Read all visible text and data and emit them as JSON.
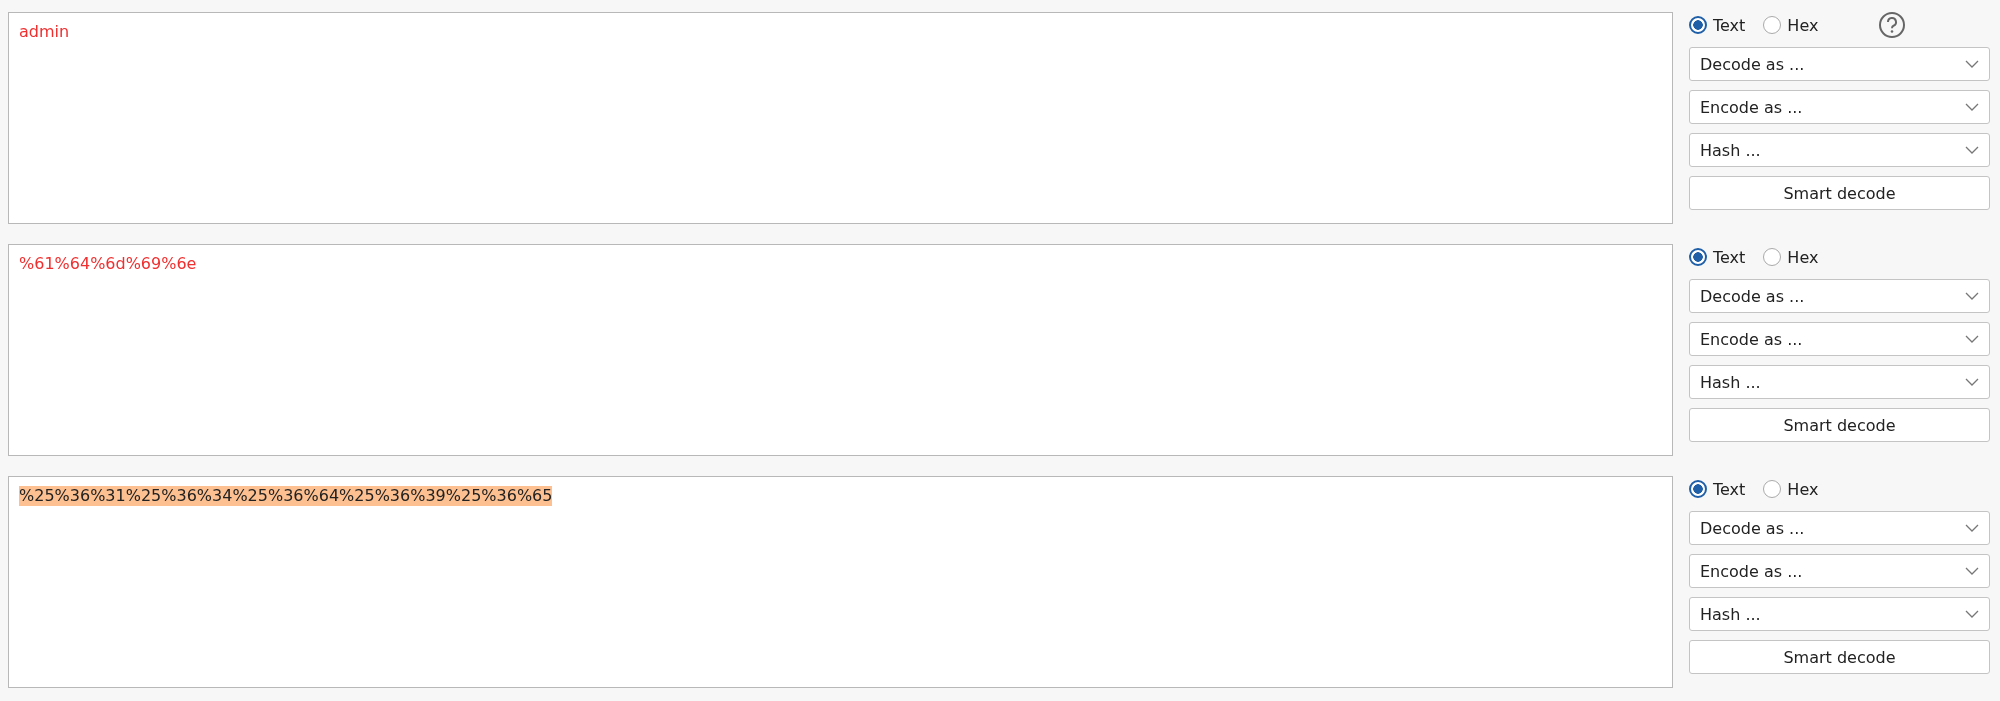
{
  "panels": [
    {
      "text": "admin",
      "kind": "modified",
      "formats": [
        {
          "label": "Text",
          "selected": true
        },
        {
          "label": "Hex",
          "selected": false
        }
      ],
      "help": true,
      "dropdowns": [
        "Decode as ...",
        "Encode as ...",
        "Hash ..."
      ],
      "button": "Smart decode"
    },
    {
      "text": "%61%64%6d%69%6e",
      "kind": "modified",
      "formats": [
        {
          "label": "Text",
          "selected": true
        },
        {
          "label": "Hex",
          "selected": false
        }
      ],
      "help": false,
      "dropdowns": [
        "Decode as ...",
        "Encode as ...",
        "Hash ..."
      ],
      "button": "Smart decode"
    },
    {
      "text": "%25%36%31%25%36%34%25%36%64%25%36%39%25%36%65",
      "kind": "selected",
      "formats": [
        {
          "label": "Text",
          "selected": true
        },
        {
          "label": "Hex",
          "selected": false
        }
      ],
      "help": false,
      "dropdowns": [
        "Decode as ...",
        "Encode as ...",
        "Hash ..."
      ],
      "button": "Smart decode"
    }
  ]
}
